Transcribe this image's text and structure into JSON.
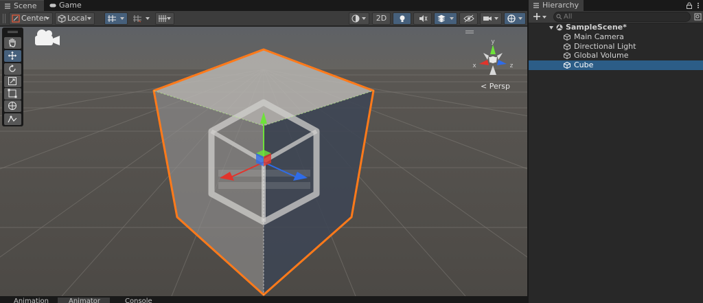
{
  "scene_tabs": {
    "scene": "Scene",
    "game": "Game"
  },
  "toolbar": {
    "pivot_mode": "Center",
    "pivot_rotation": "Local",
    "two_d": "2D"
  },
  "viewport": {
    "projection_label": "< Persp",
    "gizmo_axes": {
      "x": "x",
      "y": "y",
      "z": "z"
    }
  },
  "bottom_tabs": [
    "Animation",
    "Animator",
    "Console"
  ],
  "hierarchy": {
    "title": "Hierarchy",
    "search_placeholder": "All",
    "scene_name": "SampleScene*",
    "items": [
      {
        "label": "Main Camera",
        "selected": false
      },
      {
        "label": "Directional Light",
        "selected": false
      },
      {
        "label": "Global Volume",
        "selected": false
      },
      {
        "label": "Cube",
        "selected": true
      }
    ]
  },
  "colors": {
    "selection_outline": "#ff7a1a",
    "axis_x": "#e0342c",
    "axis_y": "#6ee23a",
    "axis_z": "#2f6ce8",
    "selected_row": "#2c5d87"
  },
  "icons": [
    "hand-icon",
    "move-icon",
    "rotate-icon",
    "scale-icon",
    "rect-icon",
    "transform-icon",
    "custom-tool-icon",
    "camera-icon",
    "lighting-icon",
    "audio-icon",
    "effects-icon",
    "visibility-icon",
    "gizmos-icon",
    "lock-icon",
    "menu-icon",
    "add-icon",
    "search-icon",
    "gameobject-icon",
    "unity-scene-icon"
  ]
}
